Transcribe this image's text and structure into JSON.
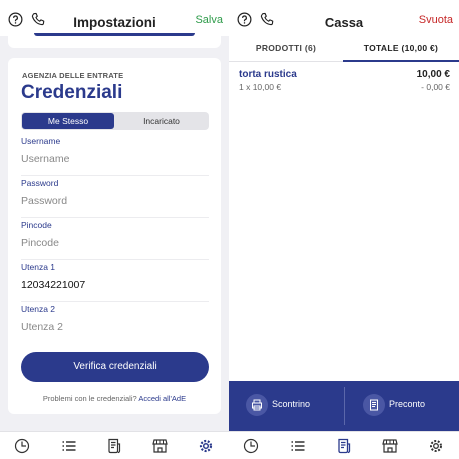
{
  "left": {
    "header": {
      "title": "Impostazioni",
      "action": "Salva"
    },
    "card": {
      "agency": "AGENZIA DELLE ENTRATE",
      "title": "Credenziali",
      "segment": {
        "options": [
          "Me Stesso",
          "Incaricato"
        ],
        "selected": "Me Stesso"
      },
      "fields": [
        {
          "label": "Username",
          "placeholder": "Username",
          "value": ""
        },
        {
          "label": "Password",
          "placeholder": "Password",
          "value": ""
        },
        {
          "label": "Pincode",
          "placeholder": "Pincode",
          "value": ""
        },
        {
          "label": "Utenza 1",
          "placeholder": "",
          "value": "12034221007"
        },
        {
          "label": "Utenza 2",
          "placeholder": "Utenza 2",
          "value": ""
        }
      ],
      "button": "Verifica credenziali",
      "help_text": "Problemi con le credenziali?",
      "help_link": "Accedi all'AdE"
    }
  },
  "right": {
    "header": {
      "title": "Cassa",
      "action": "Svuota"
    },
    "tabs": {
      "products": "PRODOTTI (6)",
      "total": "TOTALE (10,00 €)",
      "active": "total"
    },
    "item": {
      "name": "torta rustica",
      "qty": "1 x 10,00 €",
      "price": "10,00 €",
      "discount": "- 0,00 €"
    },
    "actions": {
      "receipt": "Scontrino",
      "preaccount": "Preconto"
    }
  },
  "nav_icons": [
    "clock-icon",
    "list-icon",
    "receipt-icon",
    "store-icon",
    "gear-icon"
  ],
  "colors": {
    "primary": "#2b3a8c",
    "save": "#2e9b4a",
    "empty": "#c62828"
  }
}
